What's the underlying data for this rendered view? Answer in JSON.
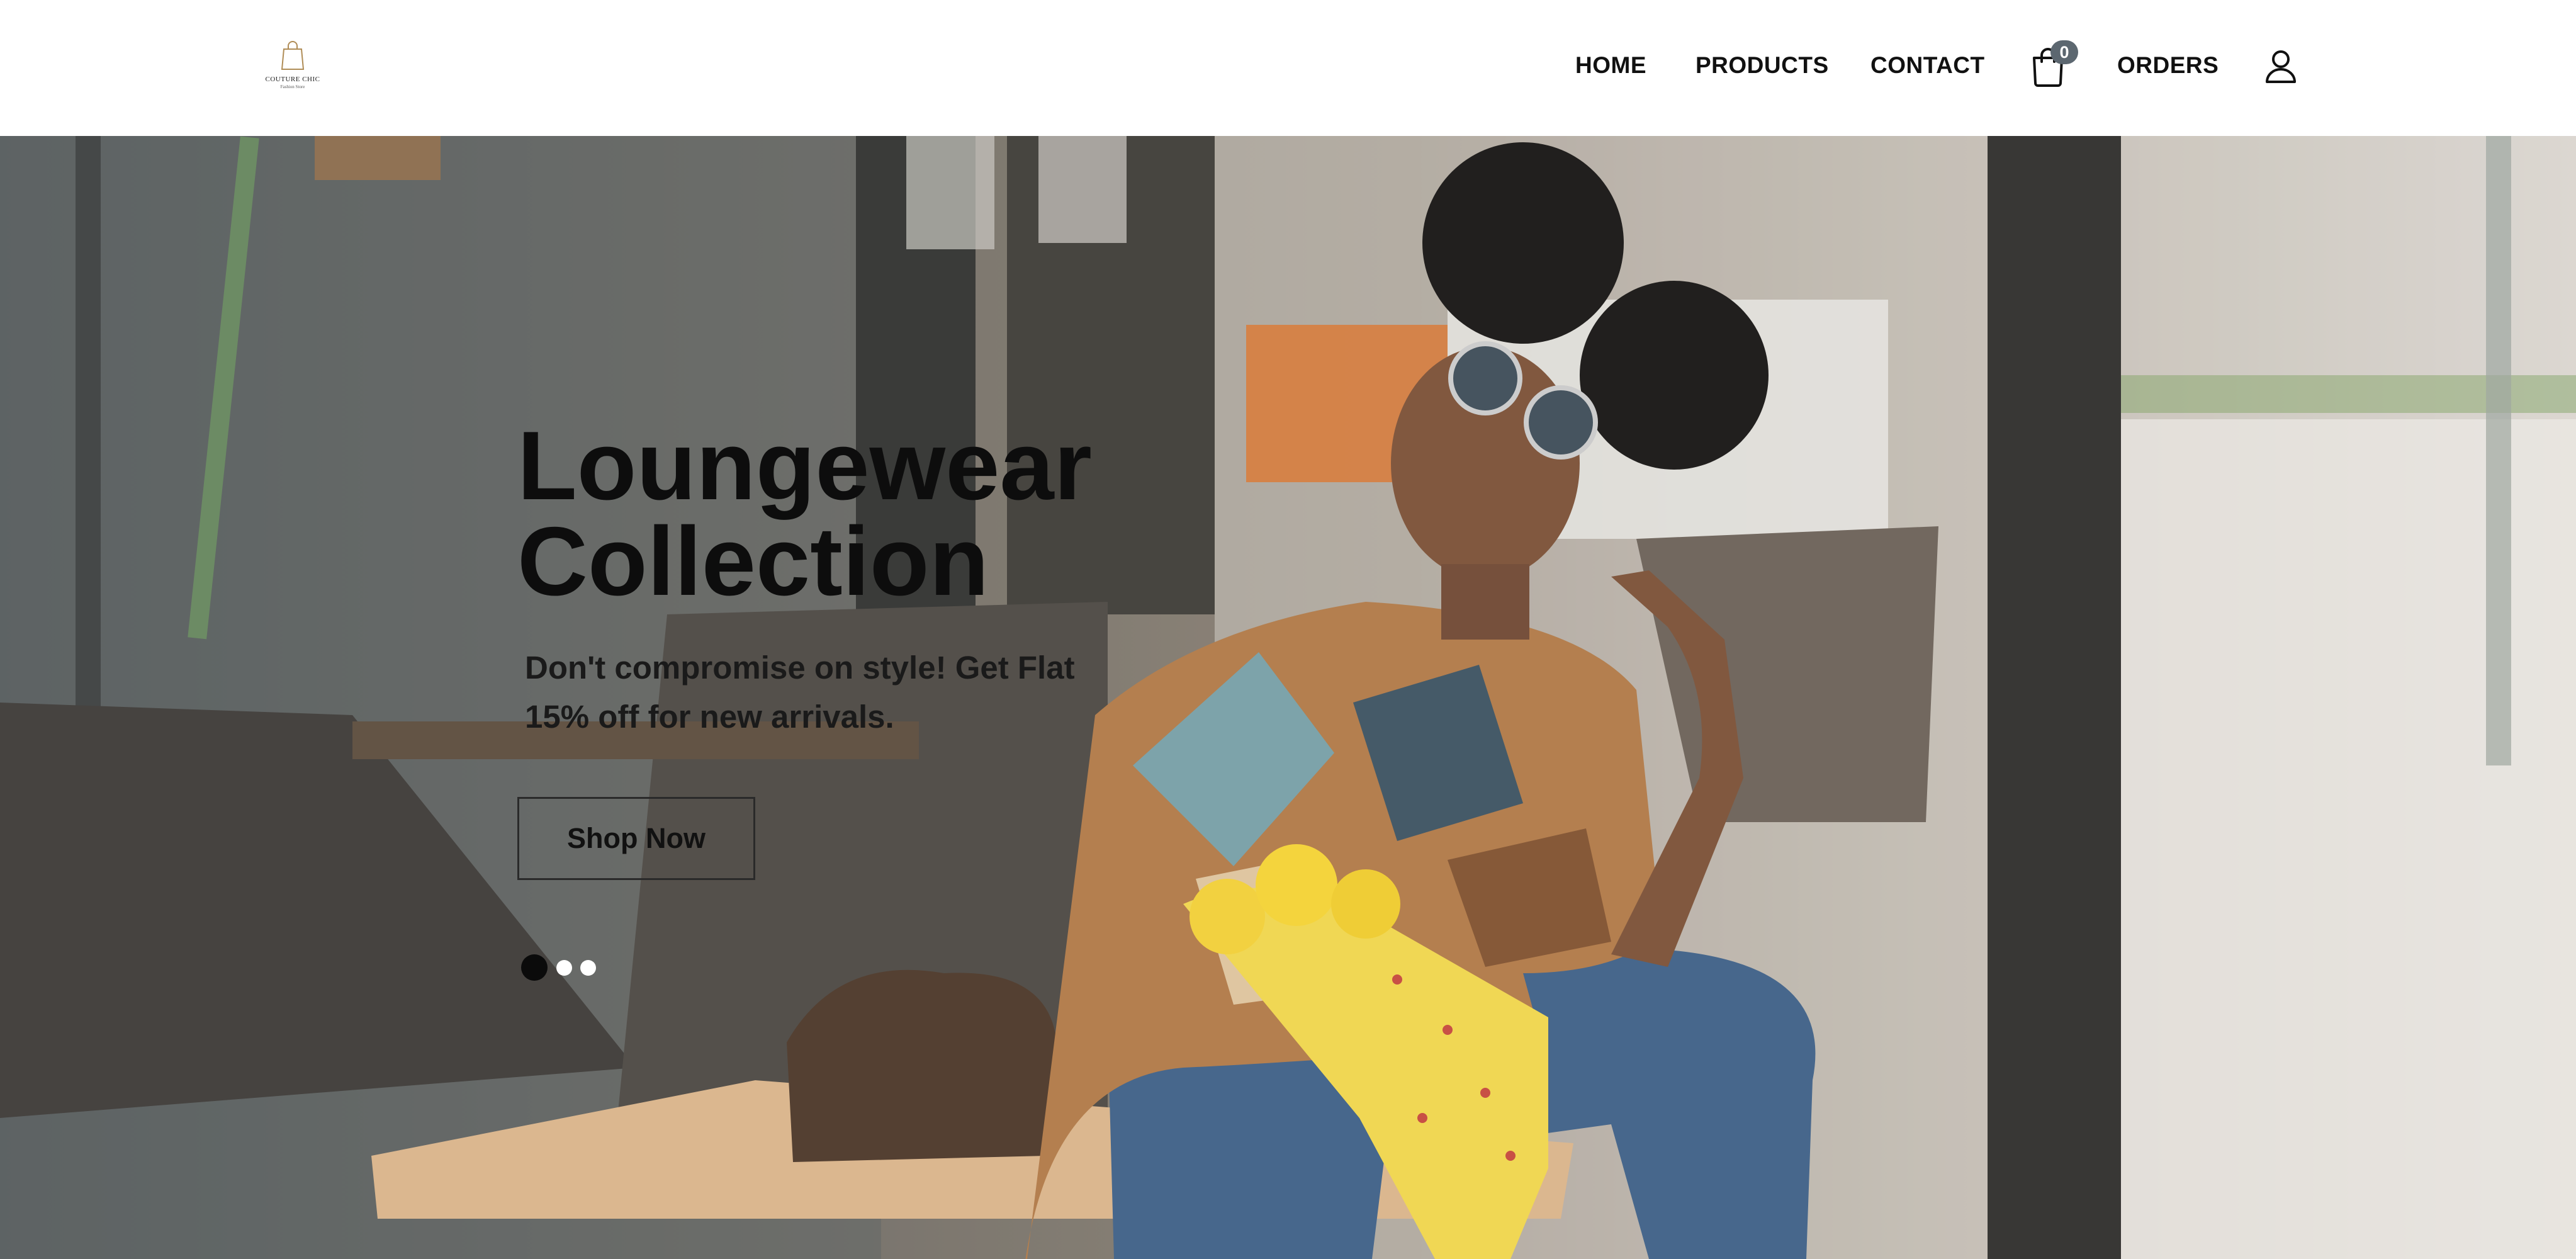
{
  "brand": {
    "name": "COUTURE CHIC",
    "tagline": "Fashion Store"
  },
  "nav": {
    "home": "HOME",
    "products": "PRODUCTS",
    "contact": "CONTACT",
    "orders": "ORDERS",
    "cart_count": "0",
    "icons": {
      "cart": "shopping-bag-icon",
      "account": "user-icon"
    }
  },
  "hero": {
    "title_line1": "Loungewear",
    "title_line2": "Collection",
    "subtitle": "Don't compromise on style! Get Flat 15% off for new arrivals.",
    "cta_label": "Shop Now",
    "slides": {
      "count": 3,
      "active": 1
    }
  },
  "colors": {
    "accent": "#111111",
    "badge": "#5c6770",
    "header_bg": "#ffffff"
  }
}
